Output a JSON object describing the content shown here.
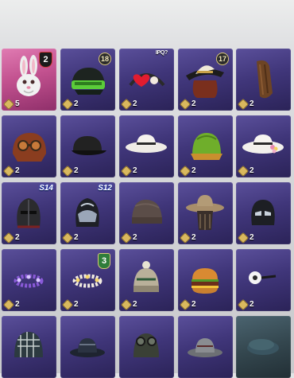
{
  "inventory": {
    "items": [
      {
        "name": "bunny-mask",
        "count": "5",
        "badge": {
          "type": "red",
          "text": "2"
        }
      },
      {
        "name": "green-beanie",
        "count": "2",
        "badge": {
          "type": "circle",
          "text": "18"
        }
      },
      {
        "name": "heart-headband",
        "count": "2",
        "badge": {
          "type": "tag",
          "text": "IPQ?"
        }
      },
      {
        "name": "cowboy-hat-hair",
        "count": "2",
        "badge": {
          "type": "circle",
          "text": "17"
        }
      },
      {
        "name": "long-hair-wig",
        "count": "2",
        "badge": null
      },
      {
        "name": "aviator-cap",
        "count": "2",
        "badge": null
      },
      {
        "name": "black-cap",
        "count": "2",
        "badge": null
      },
      {
        "name": "white-sun-hat",
        "count": "2",
        "badge": null
      },
      {
        "name": "green-helmet",
        "count": "2",
        "badge": null
      },
      {
        "name": "flower-sun-hat",
        "count": "2",
        "badge": null
      },
      {
        "name": "knight-helmet",
        "count": "2",
        "badge": {
          "type": "season",
          "text": "S14"
        }
      },
      {
        "name": "silver-helmet",
        "count": "2",
        "badge": {
          "type": "season",
          "text": "S12"
        }
      },
      {
        "name": "knit-beanie",
        "count": "2",
        "badge": null
      },
      {
        "name": "scarecrow-hat",
        "count": "2",
        "badge": null
      },
      {
        "name": "black-mask",
        "count": "2",
        "badge": null
      },
      {
        "name": "purple-flower-crown",
        "count": "2",
        "badge": null
      },
      {
        "name": "white-flower-crown",
        "count": "2",
        "badge": {
          "type": "green",
          "text": "3"
        }
      },
      {
        "name": "bobble-beanie",
        "count": "2",
        "badge": null
      },
      {
        "name": "burger-hat",
        "count": "2",
        "badge": null
      },
      {
        "name": "eyeball-hat",
        "count": "2",
        "badge": null
      },
      {
        "name": "checkered-beanie",
        "count": "",
        "badge": null
      },
      {
        "name": "bucket-hat",
        "count": "",
        "badge": null
      },
      {
        "name": "pilot-goggles-helmet",
        "count": "",
        "badge": null
      },
      {
        "name": "grey-bucket-hat",
        "count": "",
        "badge": null
      },
      {
        "name": "beret",
        "count": "",
        "badge": null
      }
    ]
  },
  "colors": {
    "cell_purple": "#40367a",
    "cell_pink": "#c2518f",
    "coin_gold": "#d9b85e",
    "badge_red_border": "#d23b3b",
    "badge_green": "#2f7d3a"
  }
}
